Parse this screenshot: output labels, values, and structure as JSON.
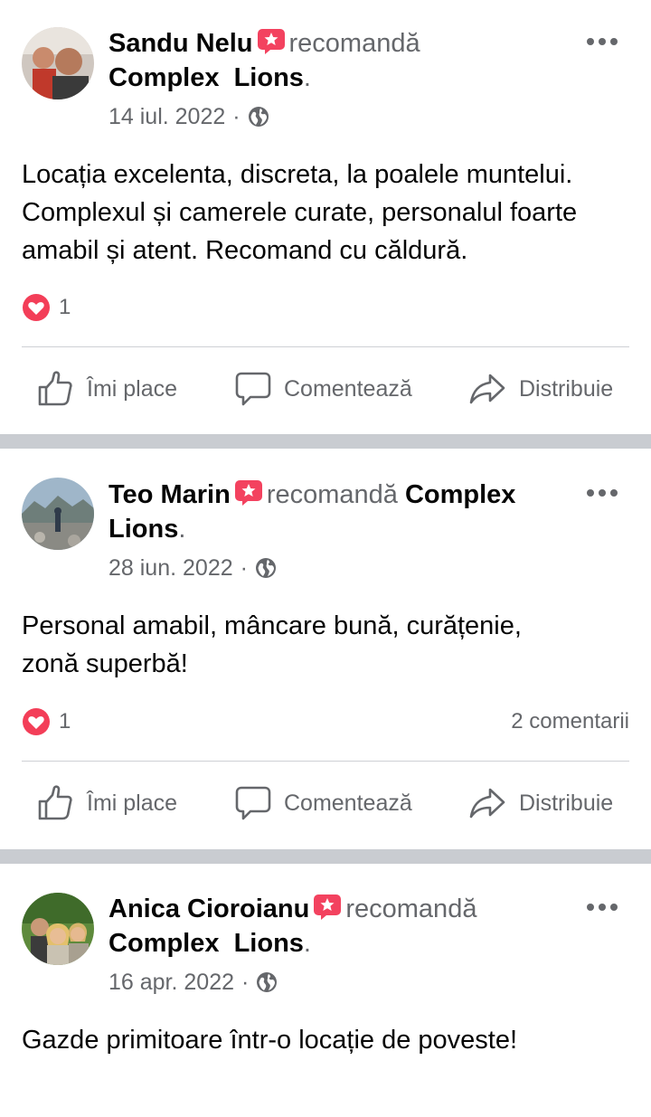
{
  "posts": [
    {
      "author": "Sandu Nelu",
      "verb": "recomandă",
      "page": "Complex  Lions",
      "end": ".",
      "date": "14 iul. 2022",
      "date_sep": "·",
      "text": "Locația excelenta, discreta, la poalele muntelui. Complexul și camerele curate, personalul foarte amabil și atent. Recomand cu căldură.",
      "reactions": "1",
      "comments": ""
    },
    {
      "author": "Teo Marin",
      "verb": "recomandă",
      "page": "Complex Lions",
      "end": ".",
      "date": "28 iun. 2022",
      "date_sep": "·",
      "text": "Personal amabil, mâncare bună, curățenie, zonă superbă!",
      "reactions": "1",
      "comments": "2 comentarii"
    },
    {
      "author": "Anica Cioroianu",
      "verb": "recomandă",
      "page": "Complex  Lions",
      "end": ".",
      "date": "16 apr. 2022",
      "date_sep": "·",
      "text": "Gazde primitoare într-o locație de poveste!"
    }
  ],
  "actions": {
    "like": "Îmi place",
    "comment": "Comentează",
    "share": "Distribuie"
  },
  "colors": {
    "text": "#050505",
    "secondary": "#65676b",
    "badge": "#f3425f",
    "heart": "#f33e58",
    "separator": "#c9ccd1"
  },
  "icons": [
    "recommendation-badge-icon",
    "globe-icon",
    "more-options-icon",
    "heart-reaction-icon",
    "like-thumb-icon",
    "comment-bubble-icon",
    "share-arrow-icon"
  ]
}
